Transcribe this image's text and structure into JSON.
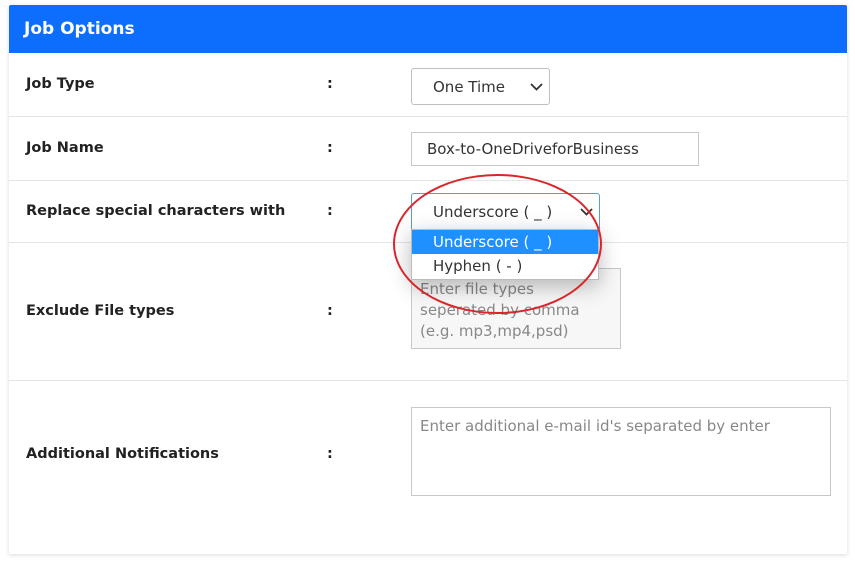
{
  "panel": {
    "title": "Job Options"
  },
  "colon": ":",
  "fields": {
    "job_type": {
      "label": "Job Type",
      "value": "One Time"
    },
    "job_name": {
      "label": "Job Name",
      "value": "Box-to-OneDriveforBusiness"
    },
    "replace_special": {
      "label": "Replace special characters with",
      "value": "Underscore ( _ )",
      "options": [
        "Underscore ( _ )",
        "Hyphen ( - )"
      ],
      "highlighted": "Underscore ( _ )"
    },
    "exclude_types": {
      "label": "Exclude File types",
      "placeholder": "Enter file types seperated by comma (e.g. mp3,mp4,psd)"
    },
    "additional_notifications": {
      "label": "Additional Notifications",
      "placeholder": "Enter additional e-mail id's separated by enter"
    }
  },
  "colors": {
    "header": "#0d6efd",
    "highlight": "#1e90ff",
    "annotation": "#d9262b"
  },
  "icons": {
    "dropdown_arrow": "chevron-down-icon"
  }
}
